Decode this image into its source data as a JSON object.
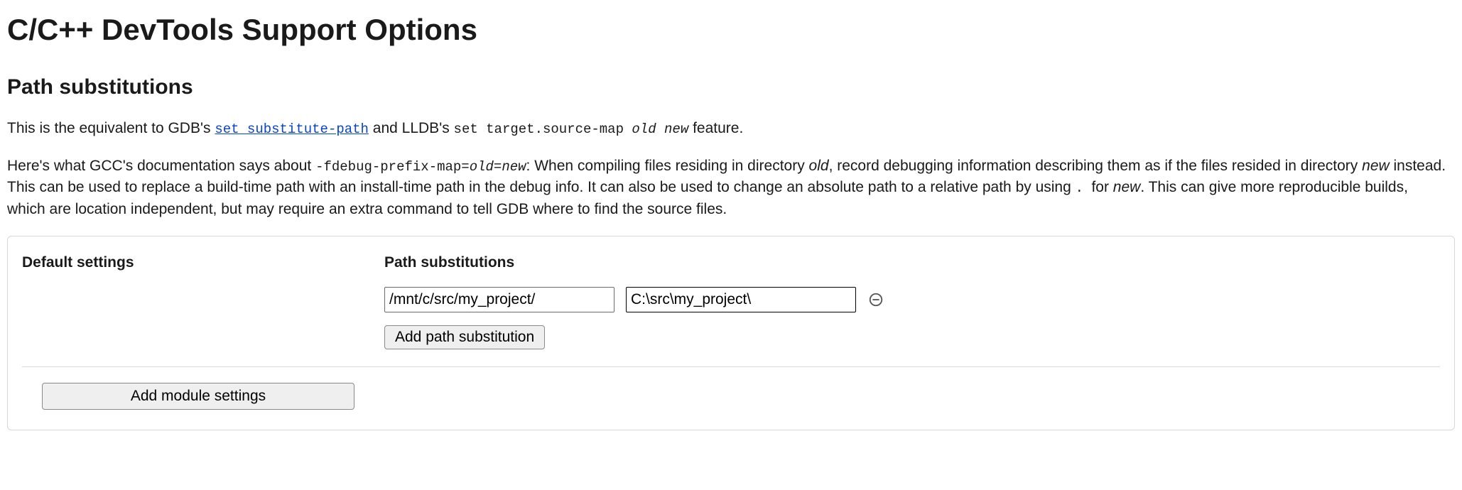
{
  "page_title": "C/C++ DevTools Support Options",
  "section_title": "Path substitutions",
  "intro": {
    "prefix": "This is the equivalent to GDB's ",
    "link_text": "set substitute-path",
    "mid": " and LLDB's ",
    "lldb_cmd": "set target.source-map ",
    "lldb_old": "old",
    "lldb_sp": " ",
    "lldb_new": "new",
    "suffix": " feature."
  },
  "doc": {
    "prefix": "Here's what GCC's documentation says about ",
    "flag": "-fdebug-prefix-map=",
    "flag_old": "old",
    "flag_eq": "=",
    "flag_new": "new",
    "after_flag": ": When compiling files residing in directory ",
    "dir_old": "old",
    "after_old": ", record debugging information describing them as if the files resided in directory ",
    "dir_new": "new",
    "after_new": " instead. This can be used to replace a build-time path with an install-time path in the debug info. It can also be used to change an absolute path to a relative path by using ",
    "dot": ". ",
    "after_dot": "for ",
    "for_new": "new",
    "tail": ". This can give more reproducible builds, which are location independent, but may require an extra command to tell GDB where to find the source files."
  },
  "panel": {
    "default_label": "Default settings",
    "subs_label": "Path substitutions",
    "from_value": "/mnt/c/src/my_project/",
    "to_value": "C:\\src\\my_project\\",
    "add_sub_label": "Add path substitution",
    "add_module_label": "Add module settings"
  }
}
